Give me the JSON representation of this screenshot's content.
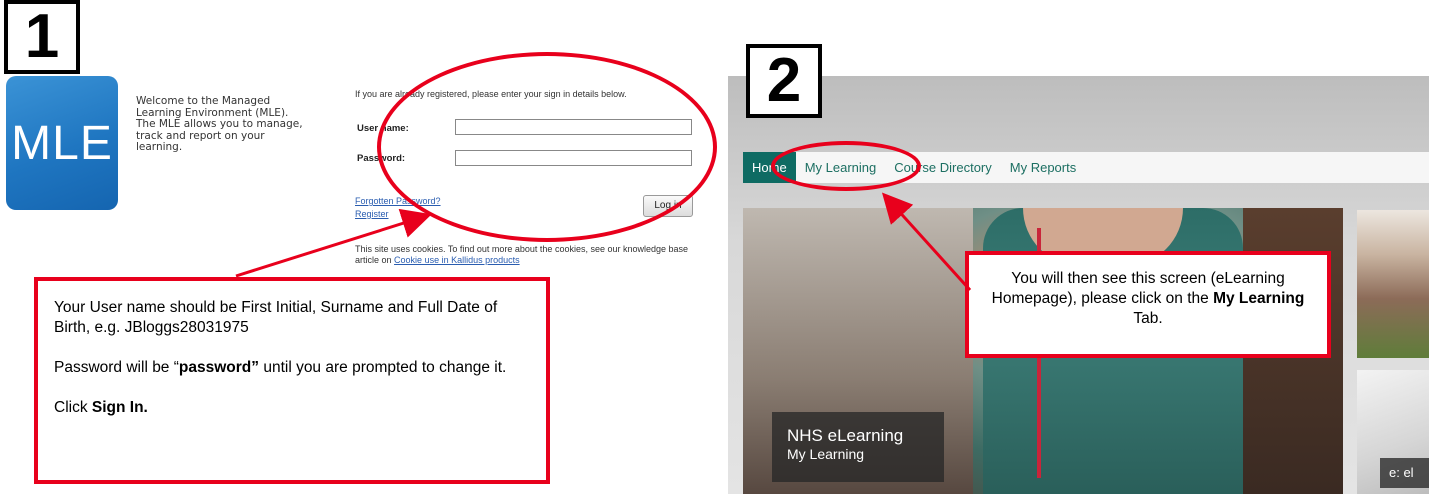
{
  "panel1": {
    "step": "1",
    "logo_text": "MLE",
    "welcome_text": "Welcome to the Managed Learning Environment (MLE). The MLE allows you to manage, track and report on your learning.",
    "registered_note": "If you are already registered, please enter your sign in details below.",
    "username_label": "User name:",
    "username_value": "",
    "password_label": "Password:",
    "password_value": "",
    "forgotten_password_link": "Forgotten Password?",
    "register_link": "Register",
    "login_button": "Log in",
    "cookie_text": "This site uses cookies. To find out more about the cookies, see our knowledge base article on",
    "cookie_link": "Cookie use in Kallidus products",
    "callout": {
      "line1": "Your User name should be First Initial, Surname and Full Date of Birth, e.g. JBloggs28031975",
      "line2_prefix": "Password will be “",
      "line2_bold": "password”",
      "line2_suffix": " until you are prompted to change it.",
      "line3_prefix": "Click ",
      "line3_bold": "Sign In."
    }
  },
  "panel2": {
    "step": "2",
    "nav": {
      "home": "Home",
      "my_learning": "My Learning",
      "course_directory": "Course Directory",
      "my_reports": "My Reports"
    },
    "hero_title": "NHS eLearning",
    "hero_subtitle": "My Learning",
    "side_tag": "e: el",
    "callout": {
      "line1": "You will then see this screen (eLearning Homepage), please click on the ",
      "bold": "My Learning",
      "suffix": " Tab."
    }
  },
  "colors": {
    "annotation_red": "#e8001c",
    "nav_teal": "#0e6b63",
    "mle_blue": "#1f76c1"
  }
}
